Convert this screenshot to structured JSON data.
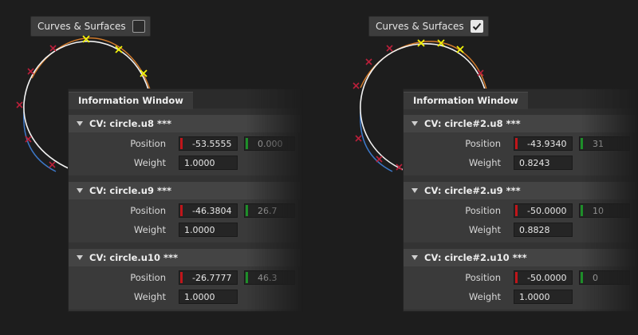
{
  "panels": [
    {
      "toggle": {
        "label": "Curves & Surfaces",
        "checked": false
      },
      "window_title": "Information Window",
      "sections": [
        {
          "title": "CV: circle.u8 ***",
          "position_label": "Position",
          "x": "-53.5555",
          "y": "0.000",
          "weight_label": "Weight",
          "weight": "1.0000"
        },
        {
          "title": "CV: circle.u9 ***",
          "position_label": "Position",
          "x": "-46.3804",
          "y": "26.7",
          "weight_label": "Weight",
          "weight": "1.0000"
        },
        {
          "title": "CV: circle.u10 ***",
          "position_label": "Position",
          "x": "-26.7777",
          "y": "46.3",
          "weight_label": "Weight",
          "weight": "1.0000"
        }
      ]
    },
    {
      "toggle": {
        "label": "Curves & Surfaces",
        "checked": true
      },
      "window_title": "Information Window",
      "sections": [
        {
          "title": "CV: circle#2.u8 ***",
          "position_label": "Position",
          "x": "-43.9340",
          "y": "31",
          "weight_label": "Weight",
          "weight": "0.8243"
        },
        {
          "title": "CV: circle#2.u9 ***",
          "position_label": "Position",
          "x": "-50.0000",
          "y": "10",
          "weight_label": "Weight",
          "weight": "0.8828"
        },
        {
          "title": "CV: circle#2.u10 ***",
          "position_label": "Position",
          "x": "-50.0000",
          "y": "0",
          "weight_label": "Weight",
          "weight": "1.0000"
        }
      ]
    }
  ],
  "colors": {
    "curve_white": "#f2f2f2",
    "curve_orange": "#d27a2a",
    "curve_blue": "#3c78c8",
    "cv_red": "#b8203a",
    "cv_yellow": "#f2f20a",
    "x_axis_marker": "#c0151a",
    "y_axis_marker": "#1e8f2a"
  }
}
